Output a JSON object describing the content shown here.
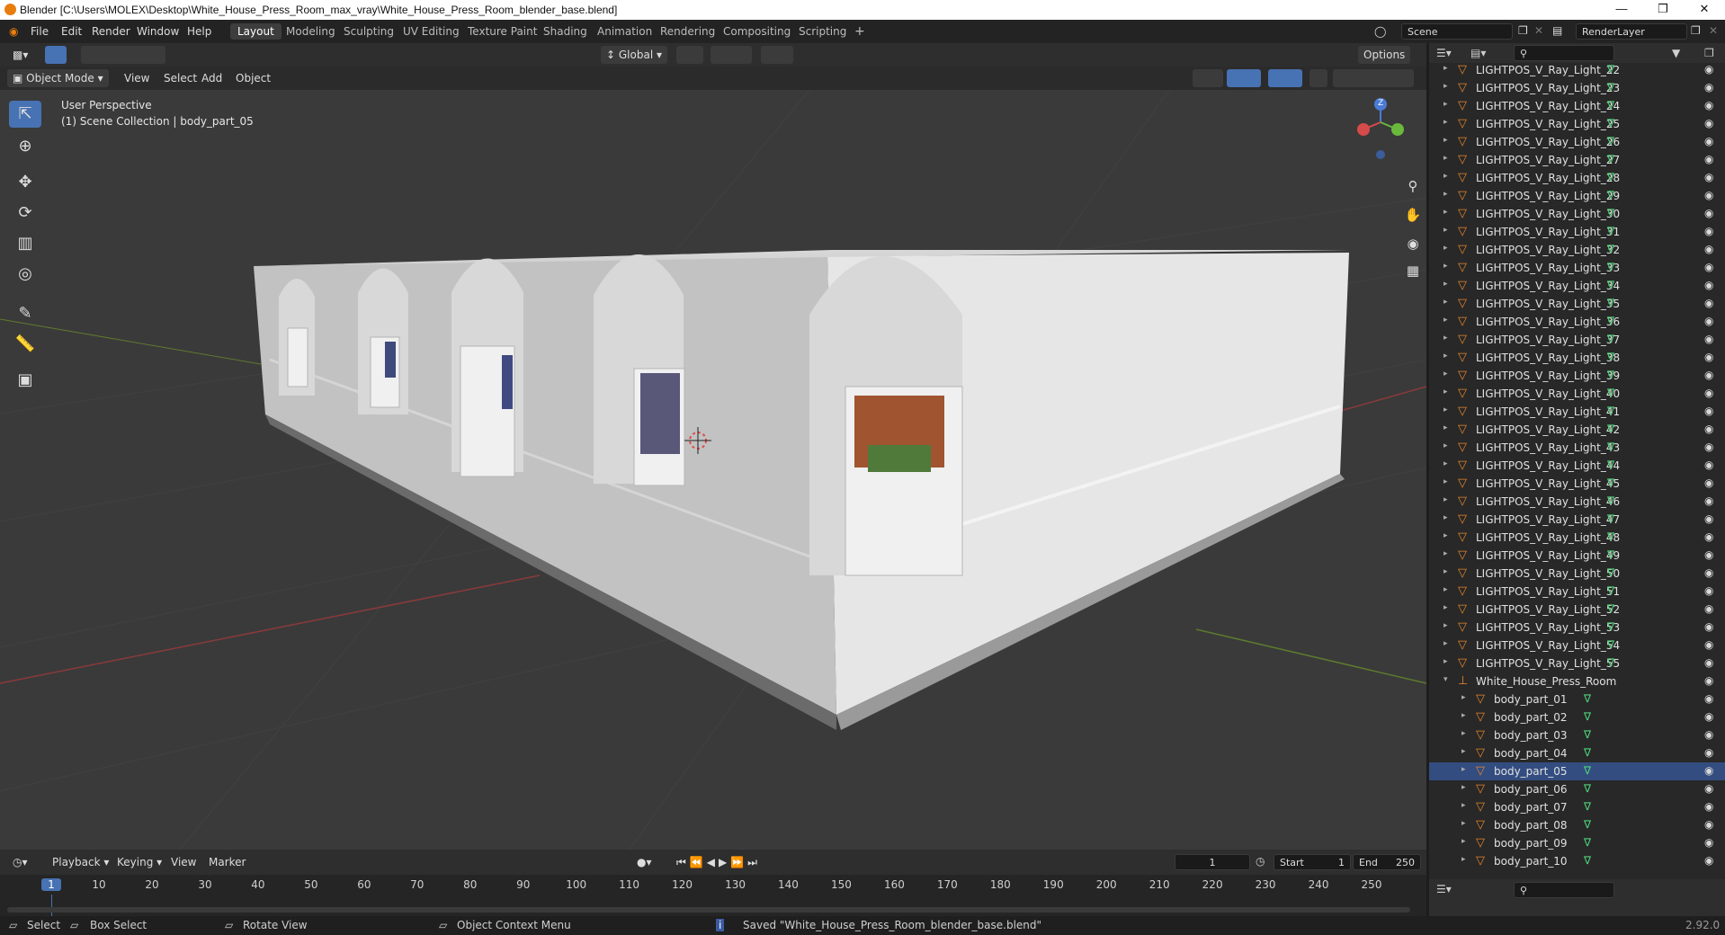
{
  "window": {
    "title": "Blender [C:\\Users\\MOLEX\\Desktop\\White_House_Press_Room_max_vray\\White_House_Press_Room_blender_base.blend]"
  },
  "menu": {
    "file": "File",
    "edit": "Edit",
    "render": "Render",
    "window": "Window",
    "help": "Help"
  },
  "workspaces": [
    "Layout",
    "Modeling",
    "Sculpting",
    "UV Editing",
    "Texture Paint",
    "Shading",
    "Animation",
    "Rendering",
    "Compositing",
    "Scripting"
  ],
  "scene": {
    "scene_name": "Scene",
    "view_layer": "RenderLayer"
  },
  "viewport": {
    "mode": "Object Mode",
    "view": "View",
    "select": "Select",
    "add": "Add",
    "object": "Object",
    "transform": "Global",
    "options": "Options",
    "perspective": "User Perspective",
    "collection_info": "(1) Scene Collection | body_part_05",
    "gizmo": {
      "z": "Z",
      "x": "X",
      "y": "Y"
    }
  },
  "outliner": {
    "lights": [
      "LIGHTPOS_V_Ray_Light_22",
      "LIGHTPOS_V_Ray_Light_23",
      "LIGHTPOS_V_Ray_Light_24",
      "LIGHTPOS_V_Ray_Light_25",
      "LIGHTPOS_V_Ray_Light_26",
      "LIGHTPOS_V_Ray_Light_27",
      "LIGHTPOS_V_Ray_Light_28",
      "LIGHTPOS_V_Ray_Light_29",
      "LIGHTPOS_V_Ray_Light_30",
      "LIGHTPOS_V_Ray_Light_31",
      "LIGHTPOS_V_Ray_Light_32",
      "LIGHTPOS_V_Ray_Light_33",
      "LIGHTPOS_V_Ray_Light_34",
      "LIGHTPOS_V_Ray_Light_35",
      "LIGHTPOS_V_Ray_Light_36",
      "LIGHTPOS_V_Ray_Light_37",
      "LIGHTPOS_V_Ray_Light_38",
      "LIGHTPOS_V_Ray_Light_39",
      "LIGHTPOS_V_Ray_Light_40",
      "LIGHTPOS_V_Ray_Light_41",
      "LIGHTPOS_V_Ray_Light_42",
      "LIGHTPOS_V_Ray_Light_43",
      "LIGHTPOS_V_Ray_Light_44",
      "LIGHTPOS_V_Ray_Light_45",
      "LIGHTPOS_V_Ray_Light_46",
      "LIGHTPOS_V_Ray_Light_47",
      "LIGHTPOS_V_Ray_Light_48",
      "LIGHTPOS_V_Ray_Light_49",
      "LIGHTPOS_V_Ray_Light_50",
      "LIGHTPOS_V_Ray_Light_51",
      "LIGHTPOS_V_Ray_Light_52",
      "LIGHTPOS_V_Ray_Light_53",
      "LIGHTPOS_V_Ray_Light_54",
      "LIGHTPOS_V_Ray_Light_55"
    ],
    "group": "White_House_Press_Room",
    "parts": [
      "body_part_01",
      "body_part_02",
      "body_part_03",
      "body_part_04",
      "body_part_05",
      "body_part_06",
      "body_part_07",
      "body_part_08",
      "body_part_09",
      "body_part_10"
    ],
    "selected": "body_part_05"
  },
  "timeline": {
    "playback": "Playback",
    "keying": "Keying",
    "view": "View",
    "marker": "Marker",
    "current_frame": "1",
    "start_label": "Start",
    "start": "1",
    "end_label": "End",
    "end": "250",
    "ticks": [
      "1",
      "10",
      "20",
      "30",
      "40",
      "50",
      "60",
      "70",
      "80",
      "90",
      "100",
      "110",
      "120",
      "130",
      "140",
      "150",
      "160",
      "170",
      "180",
      "190",
      "200",
      "210",
      "220",
      "230",
      "240",
      "250"
    ]
  },
  "status": {
    "select": "Select",
    "box_select": "Box Select",
    "rotate_view": "Rotate View",
    "context_menu": "Object Context Menu",
    "message": "Saved \"White_House_Press_Room_blender_base.blend\"",
    "version": "2.92.0"
  },
  "colors": {
    "accent": "#4772b3",
    "light_icon": "#e5862b",
    "mesh_icon": "#4fd27a"
  }
}
